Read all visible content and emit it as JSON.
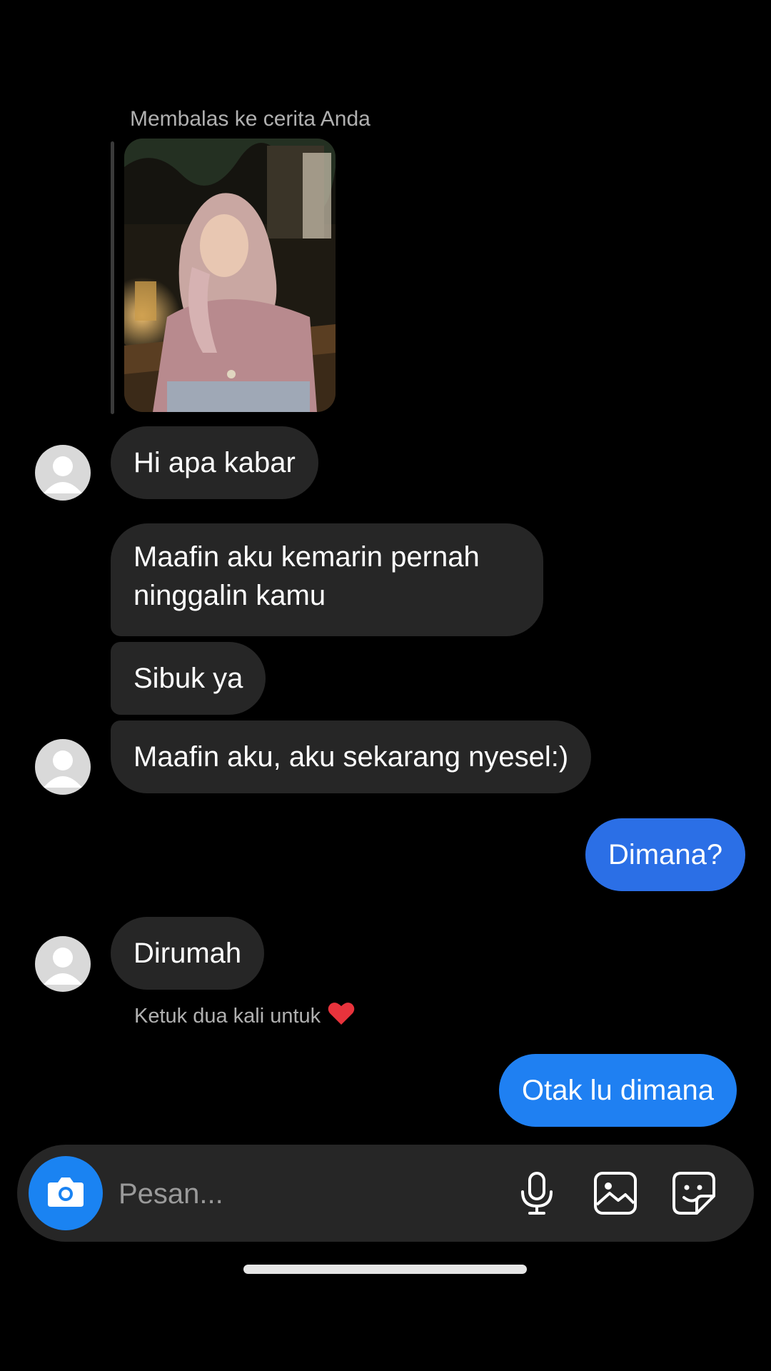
{
  "reply": {
    "label": "Membalas ke cerita Anda"
  },
  "messages": {
    "m1": "Hi apa kabar",
    "m2": "Maafin aku kemarin pernah ninggalin kamu",
    "m3": "Sibuk ya",
    "m4": "Maafin aku, aku sekarang nyesel:)",
    "m5": "Dimana?",
    "m6": "Dirumah",
    "m7": "Otak lu dimana"
  },
  "hint": {
    "text": "Ketuk dua kali untuk",
    "icon": "heart-icon"
  },
  "composer": {
    "placeholder": "Pesan..."
  },
  "icons": [
    "camera-icon",
    "microphone-icon",
    "gallery-icon",
    "sticker-icon"
  ],
  "colors": {
    "background": "#000000",
    "incoming_bubble": "#262626",
    "outgoing_bubble": "#2b6fe6",
    "accent": "#1a83f2",
    "heart": "#e8333c"
  }
}
